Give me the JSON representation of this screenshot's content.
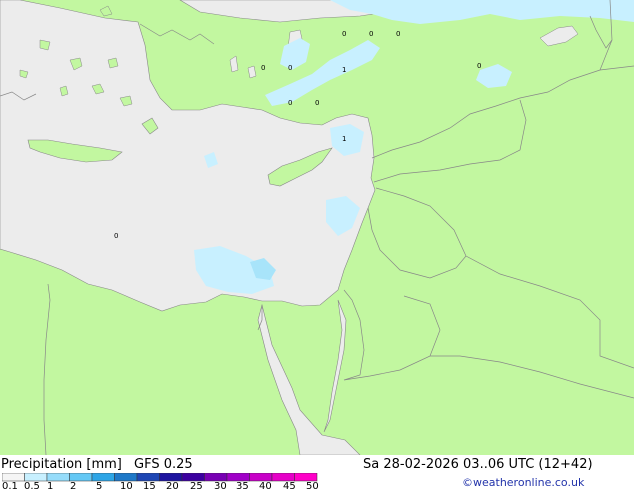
{
  "title": {
    "product": "Precipitation [mm]",
    "model": "GFS 0.25",
    "datetime": "Sa 28-02-2026 03..06 UTC (12+42)",
    "credit": "©weatheronline.co.uk"
  },
  "legend": {
    "ticks": [
      "0.1",
      "0.5",
      "1",
      "2",
      "5",
      "10",
      "15",
      "20",
      "25",
      "30",
      "35",
      "40",
      "45",
      "50"
    ],
    "colors": [
      "#f5f5f5",
      "#c8f0ff",
      "#96dcfa",
      "#64c8f5",
      "#2da5e6",
      "#1e78c8",
      "#1e46b4",
      "#1e14a0",
      "#3c00a0",
      "#7800b4",
      "#a000c8",
      "#c800c8",
      "#e600c8",
      "#ff00c8"
    ]
  },
  "map": {
    "labels": [
      "0",
      "0",
      "0",
      "0",
      "1",
      "0",
      "0",
      "0",
      "1",
      "0"
    ],
    "colors": {
      "land": "#c2f7a0",
      "sea": "#ececec",
      "border": "#888888",
      "precip_light": "#c8f0ff",
      "precip_mid": "#a8e4fa"
    }
  }
}
